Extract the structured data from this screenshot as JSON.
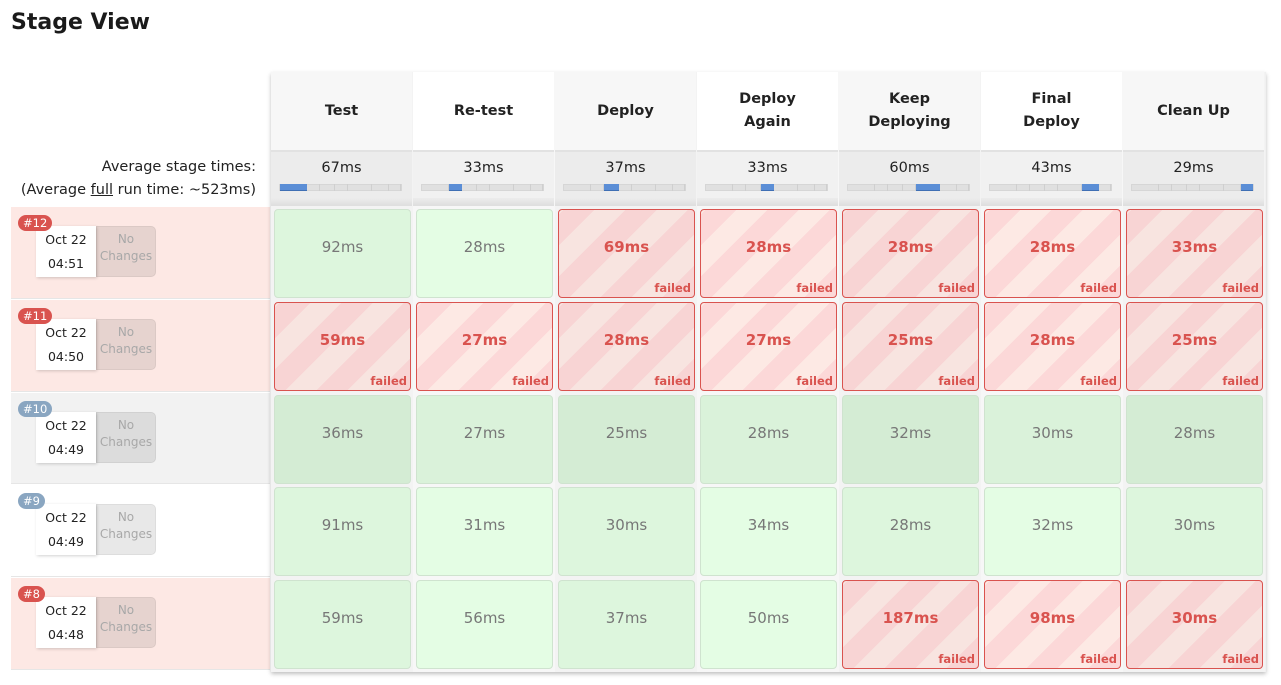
{
  "page_title": "Stage View",
  "averages_label": {
    "line1": "Average stage times:",
    "line2_prefix": "(Average ",
    "line2_link": "full",
    "line2_suffix": " run time: ~523ms)"
  },
  "colors": {
    "failed": "#d9534f",
    "success_bg": "#ddf6dd",
    "progress": "#5b8ed6",
    "badge_aborted": "#8aa6c1"
  },
  "stages": [
    {
      "name": "Test",
      "avg": "67ms",
      "avg_ms": 67
    },
    {
      "name": "Re-test",
      "avg": "33ms",
      "avg_ms": 33
    },
    {
      "name": "Deploy",
      "avg": "37ms",
      "avg_ms": 37
    },
    {
      "name": "Deploy Again",
      "avg": "33ms",
      "avg_ms": 33
    },
    {
      "name": "Keep Deploying",
      "avg": "60ms",
      "avg_ms": 60
    },
    {
      "name": "Final Deploy",
      "avg": "43ms",
      "avg_ms": 43
    },
    {
      "name": "Clean Up",
      "avg": "29ms",
      "avg_ms": 29
    }
  ],
  "runs": [
    {
      "id": "#12",
      "status": "failed",
      "date": "Oct 22",
      "time": "04:51",
      "changes": "No Changes",
      "cells": [
        {
          "dur": "92ms",
          "status": "success"
        },
        {
          "dur": "28ms",
          "status": "success"
        },
        {
          "dur": "69ms",
          "status": "failed",
          "label": "failed"
        },
        {
          "dur": "28ms",
          "status": "failed",
          "label": "failed"
        },
        {
          "dur": "28ms",
          "status": "failed",
          "label": "failed"
        },
        {
          "dur": "28ms",
          "status": "failed",
          "label": "failed"
        },
        {
          "dur": "33ms",
          "status": "failed",
          "label": "failed"
        }
      ]
    },
    {
      "id": "#11",
      "status": "failed",
      "date": "Oct 22",
      "time": "04:50",
      "changes": "No Changes",
      "cells": [
        {
          "dur": "59ms",
          "status": "failed",
          "label": "failed"
        },
        {
          "dur": "27ms",
          "status": "failed",
          "label": "failed"
        },
        {
          "dur": "28ms",
          "status": "failed",
          "label": "failed"
        },
        {
          "dur": "27ms",
          "status": "failed",
          "label": "failed"
        },
        {
          "dur": "25ms",
          "status": "failed",
          "label": "failed"
        },
        {
          "dur": "28ms",
          "status": "failed",
          "label": "failed"
        },
        {
          "dur": "25ms",
          "status": "failed",
          "label": "failed"
        }
      ]
    },
    {
      "id": "#10",
      "status": "aborted",
      "date": "Oct 22",
      "time": "04:49",
      "changes": "No Changes",
      "cells": [
        {
          "dur": "36ms",
          "status": "success-dim"
        },
        {
          "dur": "27ms",
          "status": "success-dim"
        },
        {
          "dur": "25ms",
          "status": "success-dim"
        },
        {
          "dur": "28ms",
          "status": "success-dim"
        },
        {
          "dur": "32ms",
          "status": "success-dim"
        },
        {
          "dur": "30ms",
          "status": "success-dim"
        },
        {
          "dur": "28ms",
          "status": "success-dim"
        }
      ]
    },
    {
      "id": "#9",
      "status": "plain",
      "date": "Oct 22",
      "time": "04:49",
      "changes": "No Changes",
      "cells": [
        {
          "dur": "91ms",
          "status": "success"
        },
        {
          "dur": "31ms",
          "status": "success"
        },
        {
          "dur": "30ms",
          "status": "success"
        },
        {
          "dur": "34ms",
          "status": "success"
        },
        {
          "dur": "28ms",
          "status": "success"
        },
        {
          "dur": "32ms",
          "status": "success"
        },
        {
          "dur": "30ms",
          "status": "success"
        }
      ]
    },
    {
      "id": "#8",
      "status": "failed",
      "date": "Oct 22",
      "time": "04:48",
      "changes": "No Changes",
      "cells": [
        {
          "dur": "59ms",
          "status": "success"
        },
        {
          "dur": "56ms",
          "status": "success"
        },
        {
          "dur": "37ms",
          "status": "success"
        },
        {
          "dur": "50ms",
          "status": "success"
        },
        {
          "dur": "187ms",
          "status": "failed",
          "label": "failed"
        },
        {
          "dur": "98ms",
          "status": "failed",
          "label": "failed"
        },
        {
          "dur": "30ms",
          "status": "failed",
          "label": "failed"
        }
      ]
    }
  ]
}
